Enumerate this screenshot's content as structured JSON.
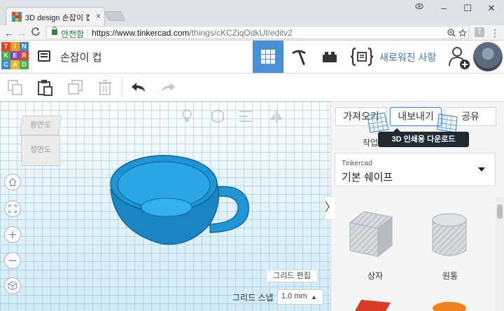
{
  "browser": {
    "tab_title": "3D design 손잡이 컵 | Ti",
    "tab_close": "×",
    "secure_label": "안전함",
    "url_host": "https://www.tinkercad.com",
    "url_path": "/things/cKCZiqOdkUf/editv2",
    "window_minimize": "–",
    "window_maximize": "☐",
    "window_close": "✕",
    "back_glyph": "←",
    "forward_glyph": "→",
    "reload_glyph": "C",
    "menu_glyph": "⋮",
    "extension_letter": "T"
  },
  "app": {
    "logo_letters": [
      "T",
      "I",
      "N",
      "K",
      "E",
      "R",
      "C",
      "A",
      "D"
    ],
    "logo_colors": [
      "#e3432a",
      "#f79a1d",
      "#3c8ad6",
      "#4aae4f",
      "#7c4bb8",
      "#e3432a",
      "#3c8ad6",
      "#f7b51d",
      "#4aae4f"
    ],
    "design_title": "손잡이 컵",
    "whats_new": "새로워진 사항"
  },
  "workplane": {
    "viewcube_top": "평면도",
    "viewcube_front": "정면도",
    "grid_edit": "그리드 편집",
    "snap_label": "그리드 스냅",
    "snap_value": "1.0 mm"
  },
  "panel": {
    "import_label": "가져오기",
    "export_label": "내보내기",
    "share_label": "공유",
    "tooltip": "3D 인쇄용 다운로드",
    "sub_left": "작업",
    "sub_right": "금자",
    "collapse_glyph": "〉",
    "shape_source_small": "Tinkercad",
    "shape_source_big": "기본 쉐이프",
    "shapes": [
      {
        "label": "상자"
      },
      {
        "label": "원통"
      }
    ]
  },
  "colors": {
    "accent_blue": "#4a90d9",
    "cup_blue": "#1e95d4",
    "box_red": "#d83a22",
    "cyl_orange": "#f0821e"
  }
}
